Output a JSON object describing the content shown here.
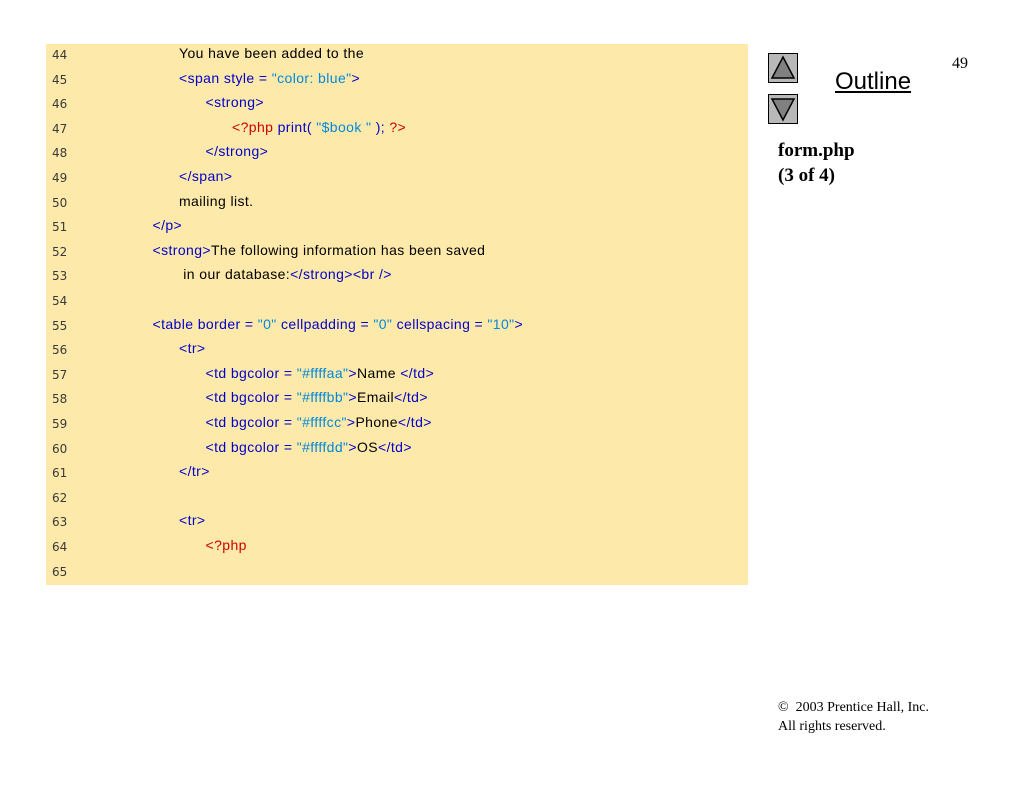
{
  "page_number": "49",
  "outline": {
    "title": "Outline",
    "up_icon": "triangle-up-icon",
    "down_icon": "triangle-down-icon"
  },
  "file": {
    "name": "form.php",
    "part": "(3 of 4)"
  },
  "footer": {
    "copyright_symbol": "©",
    "copyright": "2003 Prentice Hall, Inc.",
    "rights": "All rights reserved."
  },
  "colors": {
    "panel": "#fde9a9",
    "tag": "#0000cc",
    "text": "#000000",
    "php": "#cc0000",
    "string": "#0088dd"
  },
  "code_lines": [
    {
      "num": "44",
      "indent": 4,
      "segments": [
        {
          "t": "You have been added to the",
          "c": "black"
        }
      ]
    },
    {
      "num": "45",
      "indent": 4,
      "segments": [
        {
          "t": "<span style = ",
          "c": "blue"
        },
        {
          "t": "\"color: blue\"",
          "c": "cyan"
        },
        {
          "t": ">",
          "c": "blue"
        }
      ]
    },
    {
      "num": "46",
      "indent": 5,
      "segments": [
        {
          "t": "<strong>",
          "c": "blue"
        }
      ]
    },
    {
      "num": "47",
      "indent": 6,
      "segments": [
        {
          "t": "<?php ",
          "c": "red"
        },
        {
          "t": "print( ",
          "c": "blue"
        },
        {
          "t": "\"$book \"",
          "c": "cyan"
        },
        {
          "t": " ); ",
          "c": "blue"
        },
        {
          "t": "?>",
          "c": "red"
        }
      ]
    },
    {
      "num": "48",
      "indent": 5,
      "segments": [
        {
          "t": "</strong>",
          "c": "blue"
        }
      ]
    },
    {
      "num": "49",
      "indent": 4,
      "segments": [
        {
          "t": "</span>",
          "c": "blue"
        }
      ]
    },
    {
      "num": "50",
      "indent": 4,
      "segments": [
        {
          "t": "mailing list.",
          "c": "black"
        }
      ]
    },
    {
      "num": "51",
      "indent": 3,
      "segments": [
        {
          "t": "</p>",
          "c": "blue"
        }
      ]
    },
    {
      "num": "52",
      "indent": 3,
      "segments": [
        {
          "t": "<strong>",
          "c": "blue"
        },
        {
          "t": "The following information has been saved",
          "c": "black"
        }
      ]
    },
    {
      "num": "53",
      "indent": 4,
      "segments": [
        {
          "t": " in our database:",
          "c": "black"
        },
        {
          "t": "</strong><br />",
          "c": "blue"
        }
      ]
    },
    {
      "num": "54",
      "indent": 0,
      "segments": []
    },
    {
      "num": "55",
      "indent": 3,
      "segments": [
        {
          "t": "<table border = ",
          "c": "blue"
        },
        {
          "t": "\"0\"",
          "c": "cyan"
        },
        {
          "t": " cellpadding = ",
          "c": "blue"
        },
        {
          "t": "\"0\"",
          "c": "cyan"
        },
        {
          "t": " cellspacing = ",
          "c": "blue"
        },
        {
          "t": "\"10\"",
          "c": "cyan"
        },
        {
          "t": ">",
          "c": "blue"
        }
      ]
    },
    {
      "num": "56",
      "indent": 4,
      "segments": [
        {
          "t": "<tr>",
          "c": "blue"
        }
      ]
    },
    {
      "num": "57",
      "indent": 5,
      "segments": [
        {
          "t": "<td bgcolor = ",
          "c": "blue"
        },
        {
          "t": "\"#ffffaa\"",
          "c": "cyan"
        },
        {
          "t": ">",
          "c": "blue"
        },
        {
          "t": "Name ",
          "c": "black"
        },
        {
          "t": "</td>",
          "c": "blue"
        }
      ]
    },
    {
      "num": "58",
      "indent": 5,
      "segments": [
        {
          "t": "<td bgcolor = ",
          "c": "blue"
        },
        {
          "t": "\"#ffffbb\"",
          "c": "cyan"
        },
        {
          "t": ">",
          "c": "blue"
        },
        {
          "t": "Email",
          "c": "black"
        },
        {
          "t": "</td>",
          "c": "blue"
        }
      ]
    },
    {
      "num": "59",
      "indent": 5,
      "segments": [
        {
          "t": "<td bgcolor = ",
          "c": "blue"
        },
        {
          "t": "\"#ffffcc\"",
          "c": "cyan"
        },
        {
          "t": ">",
          "c": "blue"
        },
        {
          "t": "Phone",
          "c": "black"
        },
        {
          "t": "</td>",
          "c": "blue"
        }
      ]
    },
    {
      "num": "60",
      "indent": 5,
      "segments": [
        {
          "t": "<td bgcolor = ",
          "c": "blue"
        },
        {
          "t": "\"#ffffdd\"",
          "c": "cyan"
        },
        {
          "t": ">",
          "c": "blue"
        },
        {
          "t": "OS",
          "c": "black"
        },
        {
          "t": "</td>",
          "c": "blue"
        }
      ]
    },
    {
      "num": "61",
      "indent": 4,
      "segments": [
        {
          "t": "</tr>",
          "c": "blue"
        }
      ]
    },
    {
      "num": "62",
      "indent": 0,
      "segments": []
    },
    {
      "num": "63",
      "indent": 4,
      "segments": [
        {
          "t": "<tr>",
          "c": "blue"
        }
      ]
    },
    {
      "num": "64",
      "indent": 5,
      "segments": [
        {
          "t": "<?php",
          "c": "red"
        }
      ]
    },
    {
      "num": "65",
      "indent": 0,
      "segments": []
    }
  ]
}
